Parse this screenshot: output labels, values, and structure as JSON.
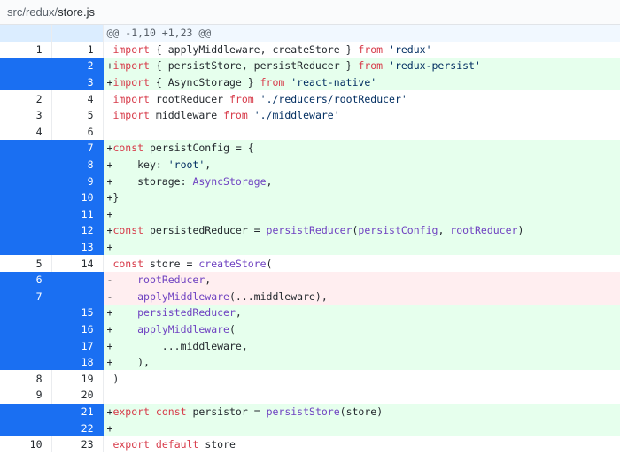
{
  "file": {
    "path_parts": [
      "src",
      "redux"
    ],
    "separator": "/",
    "name": "store.js"
  },
  "diff": {
    "rows": [
      {
        "kind": "hunk",
        "old": "",
        "new": "",
        "tokens": [
          {
            "t": "@@ -1,10 +1,23 @@",
            "c": ""
          }
        ]
      },
      {
        "kind": "ctx",
        "old": "1",
        "new": "1",
        "tokens": [
          {
            "t": " ",
            "c": ""
          },
          {
            "t": "import",
            "c": "kw"
          },
          {
            "t": " { applyMiddleware, createStore } ",
            "c": ""
          },
          {
            "t": "from",
            "c": "kw"
          },
          {
            "t": " ",
            "c": ""
          },
          {
            "t": "'redux'",
            "c": "str"
          }
        ]
      },
      {
        "kind": "add",
        "old": "",
        "new": "2",
        "tokens": [
          {
            "t": "+",
            "c": ""
          },
          {
            "t": "import",
            "c": "kw"
          },
          {
            "t": " { persistStore, persistReducer } ",
            "c": ""
          },
          {
            "t": "from",
            "c": "kw"
          },
          {
            "t": " ",
            "c": ""
          },
          {
            "t": "'redux-persist'",
            "c": "str"
          }
        ]
      },
      {
        "kind": "add",
        "old": "",
        "new": "3",
        "tokens": [
          {
            "t": "+",
            "c": ""
          },
          {
            "t": "import",
            "c": "kw"
          },
          {
            "t": " { AsyncStorage } ",
            "c": ""
          },
          {
            "t": "from",
            "c": "kw"
          },
          {
            "t": " ",
            "c": ""
          },
          {
            "t": "'react-native'",
            "c": "str"
          }
        ]
      },
      {
        "kind": "ctx",
        "old": "2",
        "new": "4",
        "tokens": [
          {
            "t": " ",
            "c": ""
          },
          {
            "t": "import",
            "c": "kw"
          },
          {
            "t": " rootReducer ",
            "c": ""
          },
          {
            "t": "from",
            "c": "kw"
          },
          {
            "t": " ",
            "c": ""
          },
          {
            "t": "'./reducers/rootReducer'",
            "c": "str"
          }
        ]
      },
      {
        "kind": "ctx",
        "old": "3",
        "new": "5",
        "tokens": [
          {
            "t": " ",
            "c": ""
          },
          {
            "t": "import",
            "c": "kw"
          },
          {
            "t": " middleware ",
            "c": ""
          },
          {
            "t": "from",
            "c": "kw"
          },
          {
            "t": " ",
            "c": ""
          },
          {
            "t": "'./middleware'",
            "c": "str"
          }
        ]
      },
      {
        "kind": "ctx",
        "old": "4",
        "new": "6",
        "tokens": [
          {
            "t": "",
            "c": ""
          }
        ]
      },
      {
        "kind": "add",
        "old": "",
        "new": "7",
        "tokens": [
          {
            "t": "+",
            "c": ""
          },
          {
            "t": "const",
            "c": "kw"
          },
          {
            "t": " persistConfig = {",
            "c": ""
          }
        ]
      },
      {
        "kind": "add",
        "old": "",
        "new": "8",
        "tokens": [
          {
            "t": "+    key: ",
            "c": ""
          },
          {
            "t": "'root'",
            "c": "str"
          },
          {
            "t": ",",
            "c": ""
          }
        ]
      },
      {
        "kind": "add",
        "old": "",
        "new": "9",
        "tokens": [
          {
            "t": "+    storage: ",
            "c": ""
          },
          {
            "t": "AsyncStorage",
            "c": "var"
          },
          {
            "t": ",",
            "c": ""
          }
        ]
      },
      {
        "kind": "add",
        "old": "",
        "new": "10",
        "tokens": [
          {
            "t": "+}",
            "c": ""
          }
        ]
      },
      {
        "kind": "add",
        "old": "",
        "new": "11",
        "tokens": [
          {
            "t": "+",
            "c": ""
          }
        ]
      },
      {
        "kind": "add",
        "old": "",
        "new": "12",
        "tokens": [
          {
            "t": "+",
            "c": ""
          },
          {
            "t": "const",
            "c": "kw"
          },
          {
            "t": " persistedReducer = ",
            "c": ""
          },
          {
            "t": "persistReducer",
            "c": "fn"
          },
          {
            "t": "(",
            "c": ""
          },
          {
            "t": "persistConfig",
            "c": "var"
          },
          {
            "t": ", ",
            "c": ""
          },
          {
            "t": "rootReducer",
            "c": "var"
          },
          {
            "t": ")",
            "c": ""
          }
        ]
      },
      {
        "kind": "add",
        "old": "",
        "new": "13",
        "tokens": [
          {
            "t": "+",
            "c": ""
          }
        ]
      },
      {
        "kind": "ctx",
        "old": "5",
        "new": "14",
        "tokens": [
          {
            "t": " ",
            "c": ""
          },
          {
            "t": "const",
            "c": "kw"
          },
          {
            "t": " store = ",
            "c": ""
          },
          {
            "t": "createStore",
            "c": "fn"
          },
          {
            "t": "(",
            "c": ""
          }
        ]
      },
      {
        "kind": "del",
        "old": "6",
        "new": "",
        "tokens": [
          {
            "t": "-    ",
            "c": ""
          },
          {
            "t": "rootReducer",
            "c": "var"
          },
          {
            "t": ",",
            "c": ""
          }
        ]
      },
      {
        "kind": "del",
        "old": "7",
        "new": "",
        "tokens": [
          {
            "t": "-    ",
            "c": ""
          },
          {
            "t": "applyMiddleware",
            "c": "fn"
          },
          {
            "t": "(...middleware),",
            "c": ""
          }
        ]
      },
      {
        "kind": "add",
        "old": "",
        "new": "15",
        "tokens": [
          {
            "t": "+    ",
            "c": ""
          },
          {
            "t": "persistedReducer",
            "c": "var"
          },
          {
            "t": ",",
            "c": ""
          }
        ]
      },
      {
        "kind": "add",
        "old": "",
        "new": "16",
        "tokens": [
          {
            "t": "+    ",
            "c": ""
          },
          {
            "t": "applyMiddleware",
            "c": "fn"
          },
          {
            "t": "(",
            "c": ""
          }
        ]
      },
      {
        "kind": "add",
        "old": "",
        "new": "17",
        "tokens": [
          {
            "t": "+        ...middleware,",
            "c": ""
          }
        ]
      },
      {
        "kind": "add",
        "old": "",
        "new": "18",
        "tokens": [
          {
            "t": "+    ),",
            "c": ""
          }
        ]
      },
      {
        "kind": "ctx",
        "old": "8",
        "new": "19",
        "tokens": [
          {
            "t": " )",
            "c": ""
          }
        ]
      },
      {
        "kind": "ctx",
        "old": "9",
        "new": "20",
        "tokens": [
          {
            "t": "",
            "c": ""
          }
        ]
      },
      {
        "kind": "add",
        "old": "",
        "new": "21",
        "tokens": [
          {
            "t": "+",
            "c": ""
          },
          {
            "t": "export",
            "c": "kw"
          },
          {
            "t": " ",
            "c": ""
          },
          {
            "t": "const",
            "c": "kw"
          },
          {
            "t": " persistor = ",
            "c": ""
          },
          {
            "t": "persistStore",
            "c": "fn"
          },
          {
            "t": "(store)",
            "c": ""
          }
        ]
      },
      {
        "kind": "add",
        "old": "",
        "new": "22",
        "tokens": [
          {
            "t": "+",
            "c": ""
          }
        ]
      },
      {
        "kind": "ctx",
        "old": "10",
        "new": "23",
        "tokens": [
          {
            "t": " ",
            "c": ""
          },
          {
            "t": "export",
            "c": "kw"
          },
          {
            "t": " ",
            "c": ""
          },
          {
            "t": "default",
            "c": "kw"
          },
          {
            "t": " store",
            "c": ""
          }
        ]
      }
    ]
  },
  "colors": {
    "added_bg": "#e6ffed",
    "deleted_bg": "#ffeef0",
    "selected_line_number_bg": "#1a6ff2",
    "hunk_bg": "#f1f8ff",
    "keyword": "#d73a49",
    "string": "#032f62",
    "function": "#6f42c1"
  }
}
